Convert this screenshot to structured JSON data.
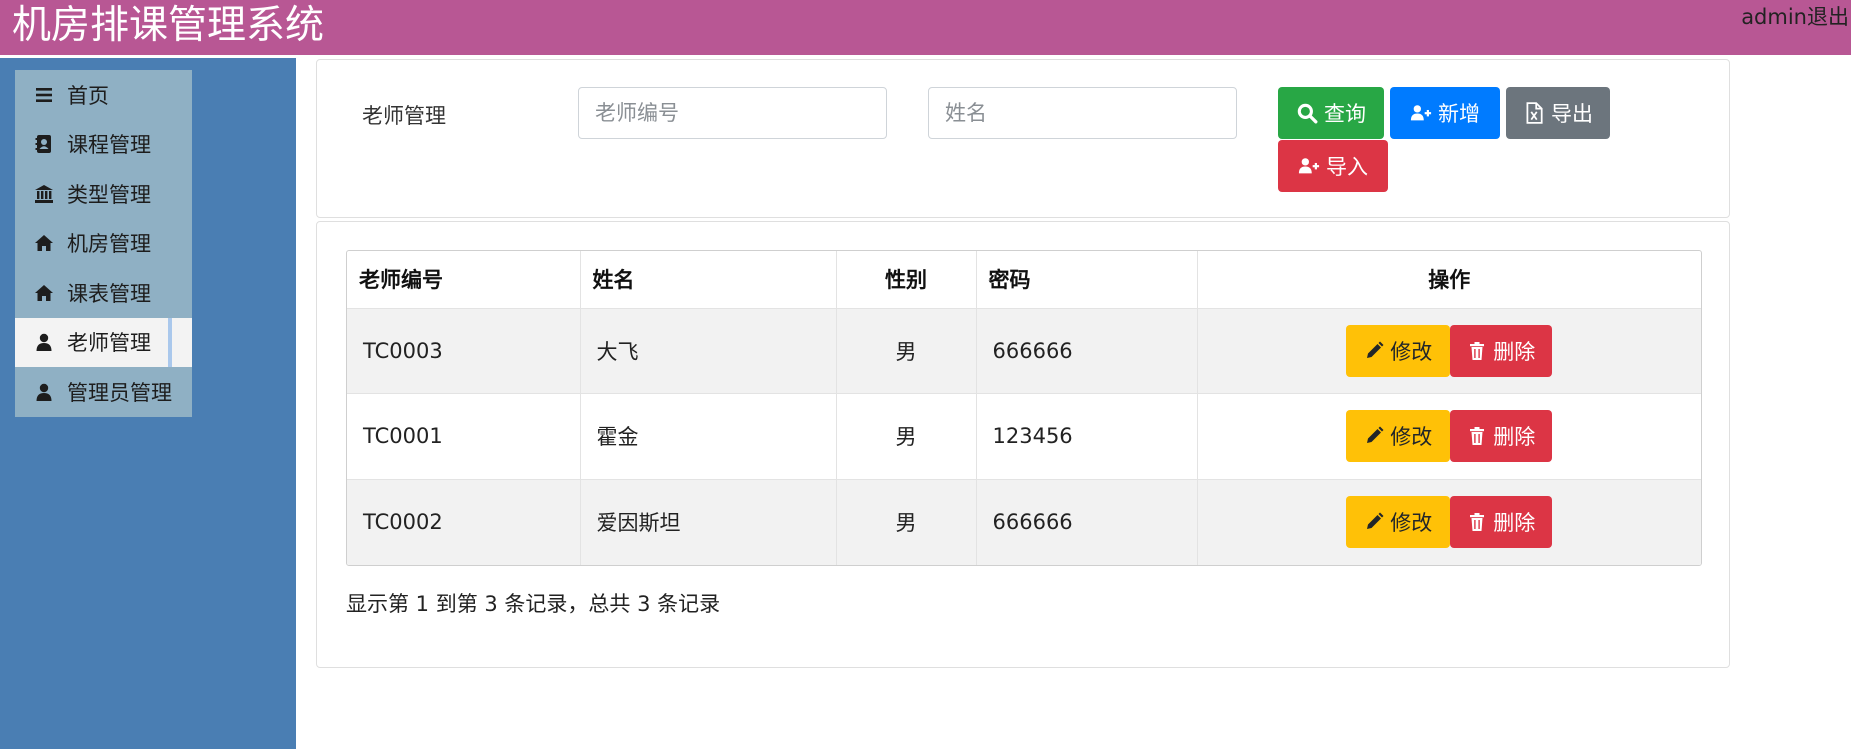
{
  "app": {
    "title": "机房排课管理系统",
    "user": "admin",
    "logout_label": "退出"
  },
  "sidebar": {
    "items": [
      {
        "label": "首页",
        "icon": "bars-icon"
      },
      {
        "label": "课程管理",
        "icon": "address-book-icon"
      },
      {
        "label": "类型管理",
        "icon": "bank-icon"
      },
      {
        "label": "机房管理",
        "icon": "home-icon"
      },
      {
        "label": "课表管理",
        "icon": "home-icon"
      },
      {
        "label": "老师管理",
        "icon": "user-icon",
        "active": true
      },
      {
        "label": "管理员管理",
        "icon": "user-icon"
      }
    ]
  },
  "search": {
    "label": "老师管理",
    "id_placeholder": "老师编号",
    "name_placeholder": "姓名",
    "query_label": "查询",
    "add_label": "新增",
    "export_label": "导出",
    "import_label": "导入"
  },
  "table": {
    "headers": [
      "老师编号",
      "姓名",
      "性别",
      "密码",
      "操作"
    ],
    "edit_label": "修改",
    "delete_label": "删除",
    "rows": [
      {
        "id": "TC0003",
        "name": "大飞",
        "gender": "男",
        "password": "666666"
      },
      {
        "id": "TC0001",
        "name": "霍金",
        "gender": "男",
        "password": "123456"
      },
      {
        "id": "TC0002",
        "name": "爱因斯坦",
        "gender": "男",
        "password": "666666"
      }
    ],
    "summary": "显示第 1 到第 3 条记录，总共 3 条记录"
  },
  "colors": {
    "header": "#b85794",
    "sidebar": "#4a7eb3",
    "nav": "#8fb0c4",
    "success": "#28a745",
    "primary": "#007bff",
    "secondary": "#6c757d",
    "danger": "#dc3545",
    "warning": "#ffc107"
  }
}
